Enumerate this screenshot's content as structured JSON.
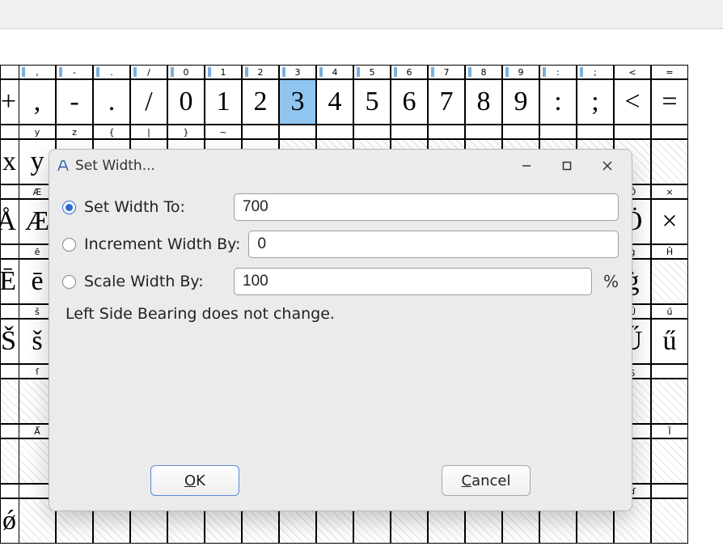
{
  "dialog": {
    "title": "Set Width...",
    "setWidthTo": {
      "label": "Set Width To:",
      "value": "700"
    },
    "incrementBy": {
      "label": "Increment Width By:",
      "value": "0"
    },
    "scaleBy": {
      "label": "Scale Width By:",
      "value": "100",
      "suffix": "%"
    },
    "note": "Left Side Bearing does not change.",
    "ok": "OK",
    "cancel": "Cancel"
  },
  "rows": [
    {
      "head": [
        ",",
        "-",
        ".",
        "/",
        "0",
        "1",
        "2",
        "3",
        "4",
        "5",
        "6",
        "7",
        "8",
        "9",
        ":",
        ";",
        "<",
        "="
      ],
      "glyph": [
        ",",
        "-",
        ".",
        "/",
        "0",
        "1",
        "2",
        "3",
        "4",
        "5",
        "6",
        "7",
        "8",
        "9",
        ":",
        ";",
        "<",
        "="
      ],
      "selected": 7,
      "marks": [
        0,
        1,
        2,
        3,
        4,
        5,
        6,
        7,
        8,
        9,
        10,
        11,
        12,
        13,
        14,
        15
      ]
    },
    {
      "head": [
        "y",
        "z",
        "{",
        "|",
        "}",
        "~",
        "",
        "",
        "",
        "",
        "",
        "",
        "",
        "",
        "",
        "",
        "",
        ""
      ],
      "glyph": [
        "y",
        "z",
        "{",
        "|",
        "}",
        "~",
        "",
        "",
        "",
        "",
        "",
        "",
        "",
        "",
        "",
        "",
        "",
        ""
      ],
      "empty": [
        7,
        8,
        9,
        10,
        11,
        12,
        13,
        14,
        15,
        16,
        17
      ]
    },
    {
      "head": [
        "Æ",
        "",
        "",
        "",
        "",
        "",
        "",
        "",
        "",
        "",
        "",
        "",
        "",
        "",
        "",
        "",
        "Ö",
        "×"
      ],
      "glyph": [
        "Æ",
        "",
        "",
        "",
        "",
        "",
        "",
        "",
        "",
        "",
        "",
        "",
        "",
        "",
        "",
        "",
        "Ö",
        "×"
      ]
    },
    {
      "head": [
        "ē",
        "",
        "",
        "",
        "",
        "",
        "",
        "",
        "",
        "",
        "",
        "",
        "",
        "",
        "",
        "",
        "ġ",
        "Ĥ"
      ],
      "glyph": [
        "ē",
        "",
        "",
        "",
        "",
        "",
        "",
        "",
        "",
        "",
        "",
        "",
        "",
        "",
        "",
        "",
        "ġ",
        ""
      ],
      "empty": [
        17
      ]
    },
    {
      "head": [
        "š",
        "",
        "",
        "",
        "",
        "",
        "",
        "",
        "",
        "",
        "",
        "",
        "",
        "",
        "",
        "",
        "Ű",
        "ű"
      ],
      "glyph": [
        "š",
        "",
        "",
        "",
        "",
        "",
        "",
        "",
        "",
        "",
        "",
        "",
        "",
        "",
        "",
        "",
        "Ű",
        "ű"
      ]
    },
    {
      "head": [
        "ſ",
        "",
        "",
        "",
        "",
        "",
        "",
        "",
        "",
        "",
        "",
        "",
        "",
        "",
        "",
        "",
        "ƽ",
        ""
      ],
      "glyph": [
        "",
        "",
        "",
        "",
        "",
        "",
        "",
        "",
        "",
        "",
        "",
        "",
        "",
        "",
        "",
        "",
        "",
        ""
      ],
      "empty": [
        0,
        1,
        2,
        3,
        4,
        5,
        6,
        7,
        8,
        9,
        10,
        11,
        12,
        13,
        14,
        15,
        16,
        17
      ]
    },
    {
      "head": [
        "Ǻ",
        "",
        "",
        "",
        "",
        "",
        "",
        "",
        "",
        "",
        "",
        "",
        "",
        "",
        "",
        "",
        "",
        "Ȉ"
      ],
      "glyph": [
        "",
        "",
        "",
        "",
        "",
        "",
        "",
        "",
        "",
        "",
        "",
        "",
        "",
        "",
        "",
        "",
        "",
        ""
      ],
      "empty": [
        0,
        1,
        2,
        3,
        4,
        5,
        6,
        7,
        8,
        9,
        10,
        11,
        12,
        13,
        14,
        15,
        16,
        17
      ]
    },
    {
      "head": [
        "",
        "",
        "",
        "",
        "",
        "",
        "",
        "",
        "",
        "",
        "",
        "",
        "",
        "",
        "",
        "",
        "ɗ",
        ""
      ],
      "glyph": [
        "",
        "",
        "",
        "",
        "",
        "",
        "",
        "",
        "",
        "",
        "",
        "",
        "",
        "",
        "",
        "",
        "",
        ""
      ],
      "empty": [
        0,
        1,
        2,
        3,
        4,
        5,
        6,
        7,
        8,
        9,
        10,
        11,
        12,
        13,
        14,
        15,
        16,
        17
      ]
    }
  ],
  "leftCol": {
    "glyphs": [
      "+",
      "x",
      "Å",
      "Ē",
      "Š",
      "",
      "",
      "ǿ"
    ],
    "empty": [
      5,
      6
    ]
  }
}
